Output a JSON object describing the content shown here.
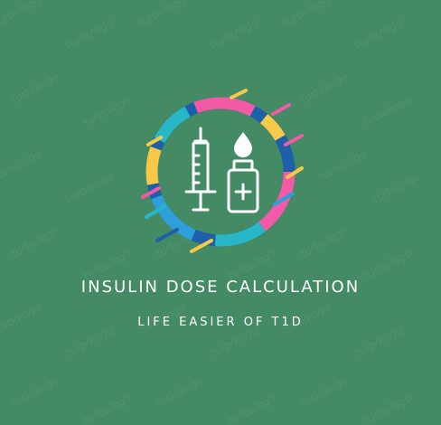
{
  "app": {
    "title": "INSULIN DOSE CALCULATION",
    "tagline": "LIFE EASIER OF T1D"
  },
  "watermark": {
    "text": "turbologo"
  },
  "logo": {
    "icons": [
      "syringe-icon",
      "drop-icon",
      "vial-icon",
      "plus-icon"
    ],
    "ring_colors": [
      "#f25aa5",
      "#f7c948",
      "#2e9fd9",
      "#27b7c6",
      "#1d5fa8"
    ]
  },
  "colors": {
    "background": "#448a64",
    "foreground": "#ffffff"
  }
}
